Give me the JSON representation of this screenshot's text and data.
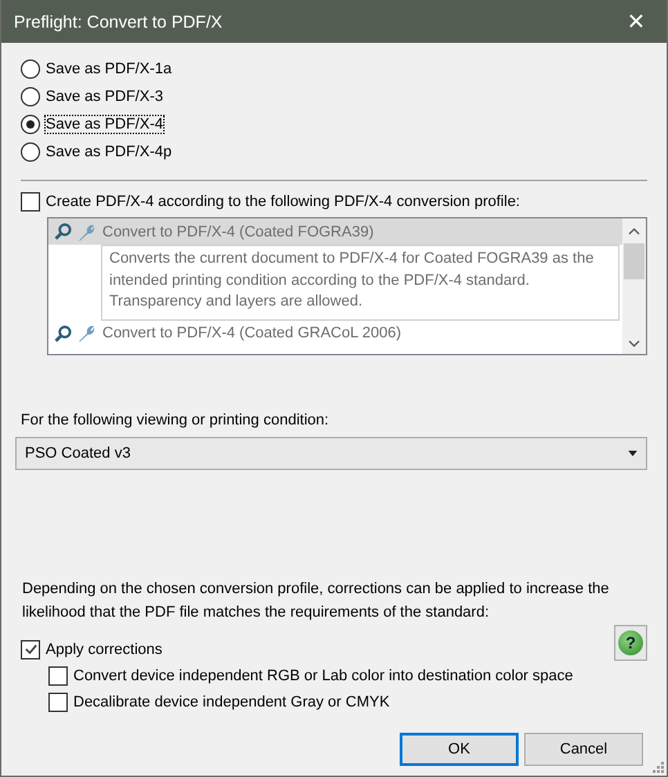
{
  "window": {
    "title": "Preflight: Convert to PDF/X",
    "close": "✕"
  },
  "formats": [
    {
      "label": "Save as PDF/X-1a",
      "selected": false
    },
    {
      "label": "Save as PDF/X-3",
      "selected": false
    },
    {
      "label": "Save as PDF/X-4",
      "selected": true
    },
    {
      "label": "Save as PDF/X-4p",
      "selected": false
    }
  ],
  "profile_option": {
    "label": "Create PDF/X-4 according to the following PDF/X-4 conversion profile:",
    "checked": false
  },
  "profiles": [
    {
      "name": "Convert to PDF/X-4 (Coated FOGRA39)",
      "selected": true,
      "description": "Converts the current document to PDF/X-4 for Coated FOGRA39 as the intended printing condition according to the PDF/X-4 standard. Transparency and layers are allowed."
    },
    {
      "name": "Convert to PDF/X-4 (Coated GRACoL 2006)",
      "selected": false
    }
  ],
  "condition": {
    "label": "For the following viewing or printing condition:",
    "value": "PSO Coated v3"
  },
  "corrections_note": "Depending on the chosen conversion profile, corrections can be applied to increase the likelihood that the PDF file matches the requirements of the standard:",
  "apply_corrections": {
    "label": "Apply corrections",
    "checked": true,
    "children": [
      {
        "label": "Convert device independent RGB or Lab color into destination color space",
        "checked": false
      },
      {
        "label": "Decalibrate device independent Gray or CMYK",
        "checked": false
      }
    ]
  },
  "help": "?",
  "buttons": [
    {
      "label": "OK",
      "default": true
    },
    {
      "label": "Cancel",
      "default": false
    }
  ]
}
